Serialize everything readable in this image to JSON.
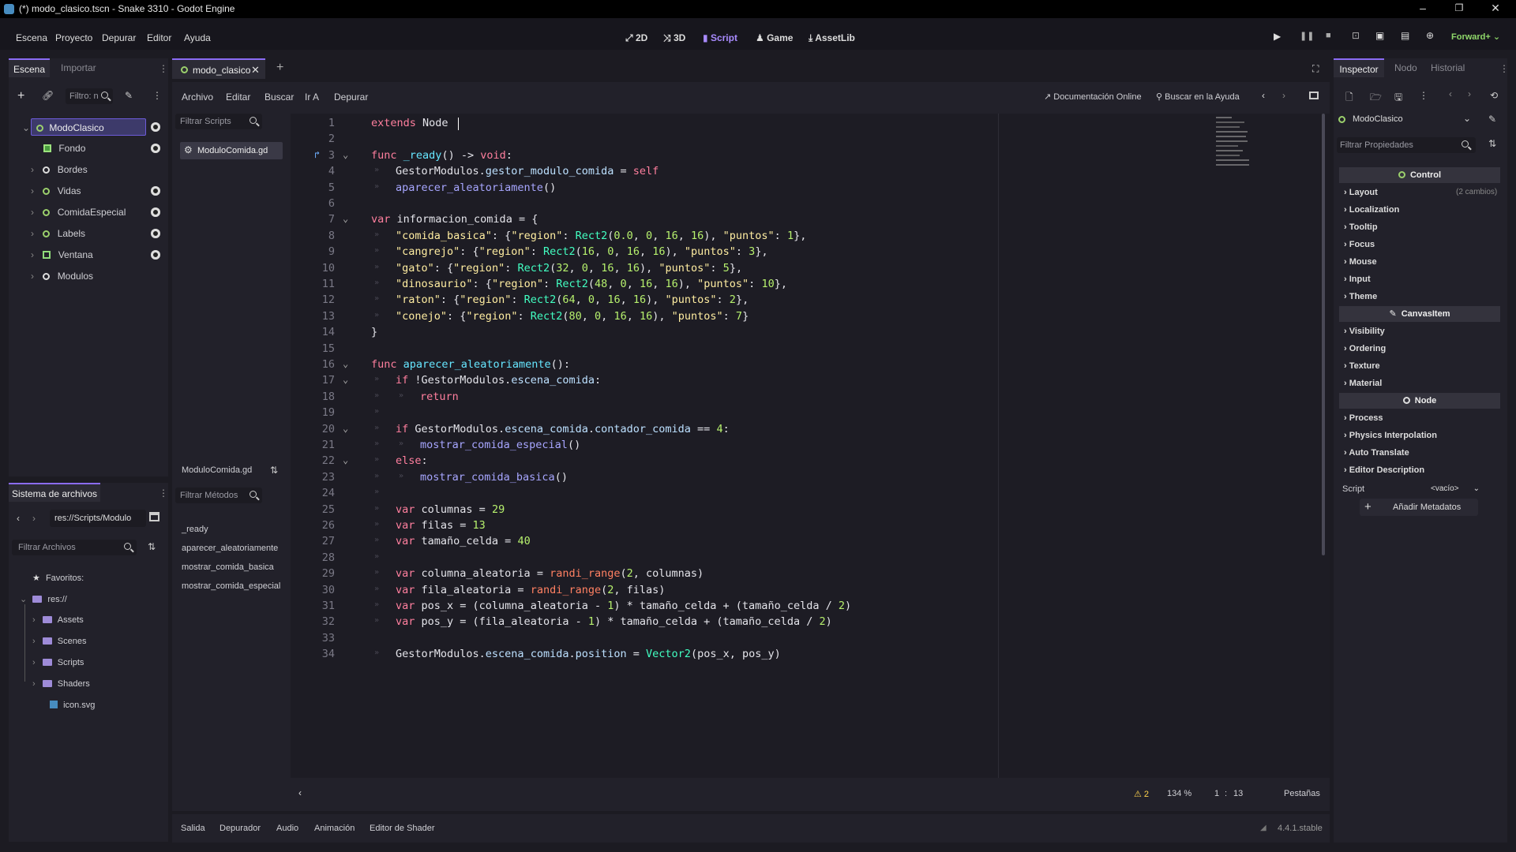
{
  "window": {
    "title": "(*) modo_clasico.tscn - Snake 3310 - Godot Engine",
    "min": "–",
    "max": "❐",
    "close": "✕"
  },
  "menu": [
    "Escena",
    "Proyecto",
    "Depurar",
    "Editor",
    "Ayuda"
  ],
  "main_tabs": [
    {
      "label": "2D"
    },
    {
      "label": "3D"
    },
    {
      "label": "Script"
    },
    {
      "label": "Game"
    },
    {
      "label": "AssetLib"
    }
  ],
  "renderer": "Forward+",
  "scene_panel": {
    "tabs": [
      "Escena",
      "Importar"
    ],
    "filter_placeholder": "Filtro: n",
    "nodes": [
      {
        "name": "ModoClasico",
        "icon": "ring-green",
        "eye": true,
        "indent": 0,
        "selected": true
      },
      {
        "name": "Fondo",
        "icon": "texture-green",
        "eye": true,
        "indent": 1
      },
      {
        "name": "Bordes",
        "icon": "ring-white",
        "eye": false,
        "indent": 1
      },
      {
        "name": "Vidas",
        "icon": "ring-green",
        "eye": true,
        "indent": 1
      },
      {
        "name": "ComidaEspecial",
        "icon": "ring-green",
        "eye": true,
        "indent": 1
      },
      {
        "name": "Labels",
        "icon": "ring-green",
        "eye": true,
        "indent": 1
      },
      {
        "name": "Ventana",
        "icon": "square-green",
        "eye": true,
        "indent": 1
      },
      {
        "name": "Modulos",
        "icon": "ring-white",
        "eye": false,
        "indent": 1
      }
    ]
  },
  "filesystem": {
    "title": "Sistema de archivos",
    "path": "res://Scripts/Modulo",
    "filter_placeholder": "Filtrar Archivos",
    "favorites": "Favoritos:",
    "root": "res://",
    "items": [
      "Assets",
      "Scenes",
      "Scripts",
      "Shaders",
      "icon.svg"
    ]
  },
  "script_editor": {
    "file_tab": "modo_clasico",
    "menu": [
      "Archivo",
      "Editar",
      "Buscar",
      "Ir A",
      "Depurar"
    ],
    "online_docs": "Documentación Online",
    "search_help": "Buscar en la Ayuda",
    "filter_scripts": "Filtrar Scripts",
    "scripts": [
      "ModuloComida.gd"
    ],
    "methods_title": "ModuloComida.gd",
    "filter_methods": "Filtrar Métodos",
    "methods": [
      "_ready",
      "aparecer_aleatoriamente",
      "mostrar_comida_basica",
      "mostrar_comida_especial"
    ],
    "status": {
      "warnings": "2",
      "zoom": "134 %",
      "line": "1",
      "col": "13",
      "indent": "Pestañas"
    }
  },
  "code": [
    "extends Node",
    "",
    "func _ready() -> void:",
    "\tGestorModulos.gestor_modulo_comida = self",
    "\taparecer_aleatoriamente()",
    "",
    "var informacion_comida = {",
    "\t\"comida_basica\": {\"region\": Rect2(0.0, 0, 16, 16), \"puntos\": 1},",
    "\t\"cangrejo\": {\"region\": Rect2(16, 0, 16, 16), \"puntos\": 3},",
    "\t\"gato\": {\"region\": Rect2(32, 0, 16, 16), \"puntos\": 5},",
    "\t\"dinosaurio\": {\"region\": Rect2(48, 0, 16, 16), \"puntos\": 10},",
    "\t\"raton\": {\"region\": Rect2(64, 0, 16, 16), \"puntos\": 2},",
    "\t\"conejo\": {\"region\": Rect2(80, 0, 16, 16), \"puntos\": 7}",
    "}",
    "",
    "func aparecer_aleatoriamente():",
    "\tif !GestorModulos.escena_comida:",
    "\t\treturn",
    "\t",
    "\tif GestorModulos.escena_comida.contador_comida == 4:",
    "\t\tmostrar_comida_especial()",
    "\telse:",
    "\t\tmostrar_comida_basica()",
    "\t",
    "\tvar columnas = 29",
    "\tvar filas = 13",
    "\tvar tamaño_celda = 40",
    "\t",
    "\tvar columna_aleatoria = randi_range(2, columnas)",
    "\tvar fila_aleatoria = randi_range(2, filas)",
    "\tvar pos_x = (columna_aleatoria - 1) * tamaño_celda + (tamaño_celda / 2)",
    "\tvar pos_y = (fila_aleatoria - 1) * tamaño_celda + (tamaño_celda / 2)",
    "",
    "\tGestorModulos.escena_comida.position = Vector2(pos_x, pos_y)"
  ],
  "inspector": {
    "tabs": [
      "Inspector",
      "Nodo",
      "Historial"
    ],
    "node": "ModoClasico",
    "filter_placeholder": "Filtrar Propiedades",
    "sections": [
      {
        "title": "Control",
        "rows": [
          {
            "label": "Layout",
            "note": "(2 cambios)"
          },
          {
            "label": "Localization"
          },
          {
            "label": "Tooltip"
          },
          {
            "label": "Focus"
          },
          {
            "label": "Mouse"
          },
          {
            "label": "Input"
          },
          {
            "label": "Theme"
          }
        ]
      },
      {
        "title": "CanvasItem",
        "rows": [
          {
            "label": "Visibility"
          },
          {
            "label": "Ordering"
          },
          {
            "label": "Texture"
          },
          {
            "label": "Material"
          }
        ]
      },
      {
        "title": "Node",
        "rows": [
          {
            "label": "Process"
          },
          {
            "label": "Physics Interpolation"
          },
          {
            "label": "Auto Translate"
          },
          {
            "label": "Editor Description"
          }
        ]
      }
    ],
    "script_label": "Script",
    "script_value": "<vacío>",
    "add_meta": "Añadir Metadatos"
  },
  "bottom_tabs": [
    "Salida",
    "Depurador",
    "Audio",
    "Animación",
    "Editor de Shader"
  ],
  "version": "4.4.1.stable"
}
